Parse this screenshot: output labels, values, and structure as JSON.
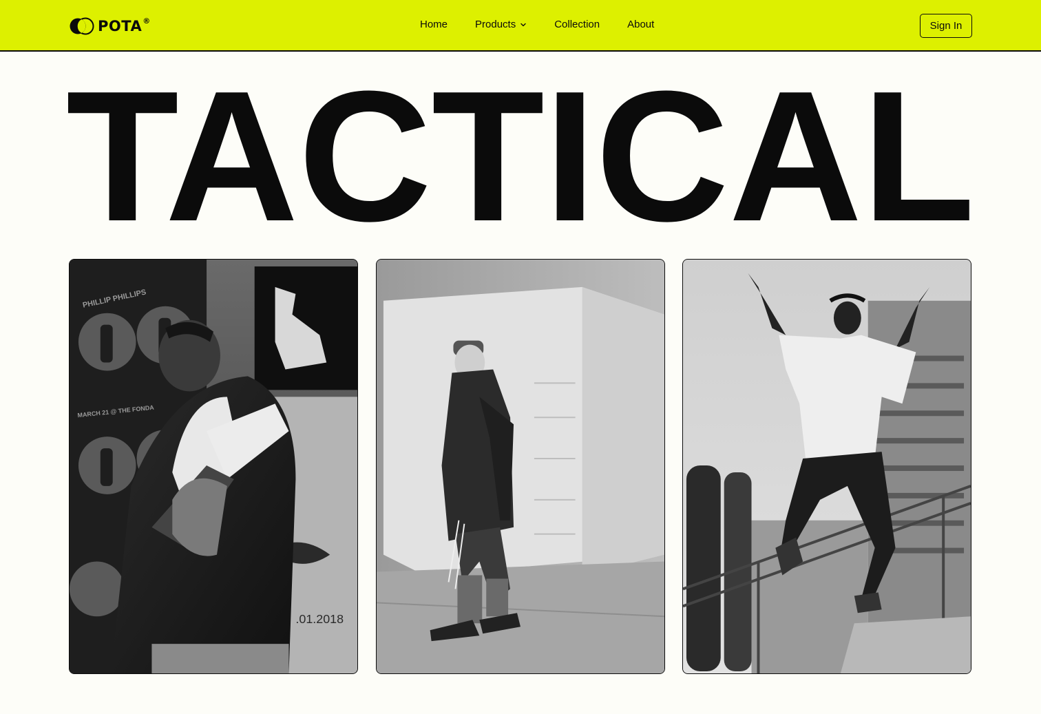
{
  "brand": {
    "name": "POTA",
    "registered_mark": "®",
    "logo_icon": "overlapping-circles-icon"
  },
  "nav": {
    "items": [
      {
        "label": "Home"
      },
      {
        "label": "Products",
        "icon": "chevron-down-icon"
      },
      {
        "label": "Collection"
      },
      {
        "label": "About"
      }
    ]
  },
  "header": {
    "sign_in_label": "Sign In"
  },
  "hero": {
    "headline": "TACTICAL"
  },
  "gallery": {
    "photo1": {
      "poster_name": "PHILLIP PHILLIPS",
      "poster_line": "MARCH 21 @ THE FONDA",
      "wall_date": ".01.2018"
    }
  },
  "colors": {
    "accent": "#ddf000",
    "background": "#fdfdf8",
    "ink": "#0b0b0b"
  }
}
